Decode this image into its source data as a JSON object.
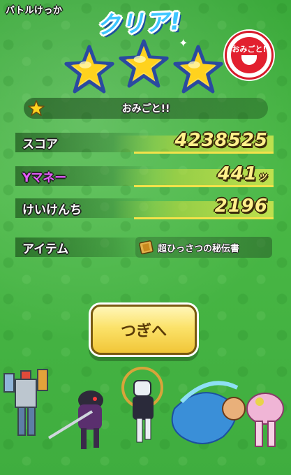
{
  "header": {
    "battle_result_label": "バトルけっか",
    "clear_label": "クリア!"
  },
  "rating": {
    "stars_earned": 3,
    "stars_total": 3,
    "badge_text": "おみごと!"
  },
  "banner": {
    "text": "おみごと!!"
  },
  "results": {
    "score_label": "スコア",
    "score_value": "4238525",
    "money_label": "Yマネー",
    "money_value": "441",
    "money_unit": "ッ",
    "exp_label": "けいけんち",
    "exp_value": "2196",
    "item_label": "アイテム",
    "item_name": "超ひっさつの秘伝書"
  },
  "actions": {
    "next_label": "つぎへ"
  },
  "colors": {
    "background": "#45b341",
    "title_blue": "#3ec6ff",
    "value_yellow": "#fff08a",
    "money_label_purple": "#e65cff",
    "button_yellow": "#fbe26a",
    "badge_red": "#e2202f"
  },
  "icons": {
    "star": "star-icon",
    "item": "scroll-book-icon"
  }
}
